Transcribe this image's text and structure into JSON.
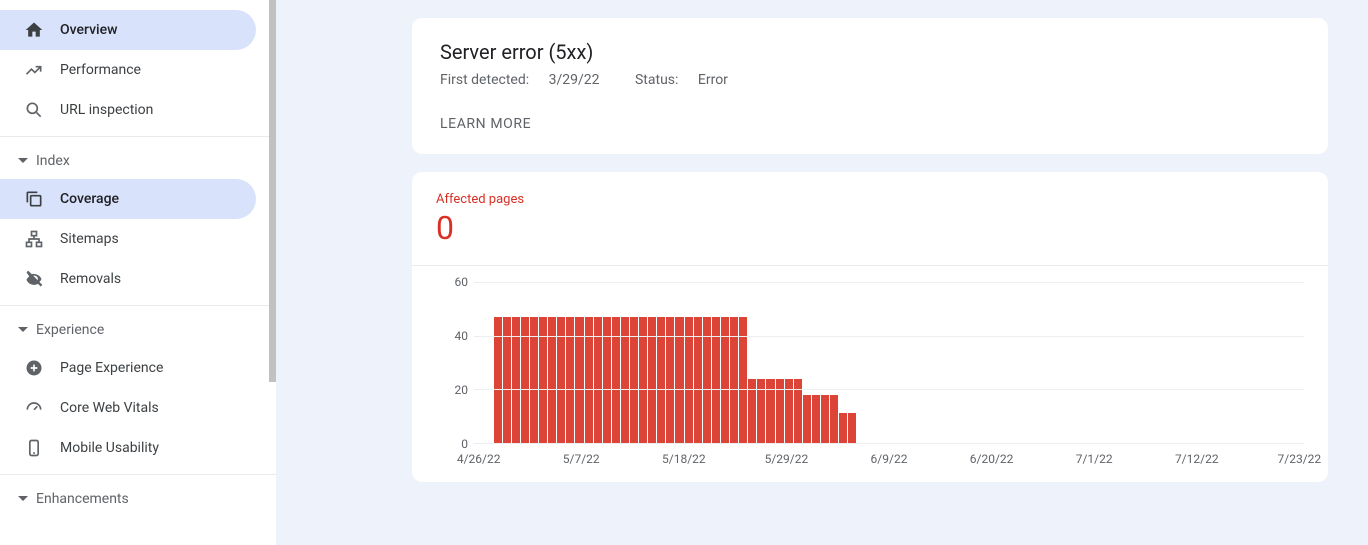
{
  "sidebar": {
    "items": [
      {
        "label": "Overview",
        "icon": "home"
      },
      {
        "label": "Performance",
        "icon": "trending"
      },
      {
        "label": "URL inspection",
        "icon": "search"
      }
    ],
    "sections": [
      {
        "label": "Index",
        "items": [
          {
            "label": "Coverage",
            "icon": "copy",
            "selected": true
          },
          {
            "label": "Sitemaps",
            "icon": "sitemap"
          },
          {
            "label": "Removals",
            "icon": "strike"
          }
        ]
      },
      {
        "label": "Experience",
        "items": [
          {
            "label": "Page Experience",
            "icon": "plus-circle"
          },
          {
            "label": "Core Web Vitals",
            "icon": "speed"
          },
          {
            "label": "Mobile Usability",
            "icon": "mobile"
          }
        ]
      },
      {
        "label": "Enhancements",
        "items": []
      }
    ]
  },
  "header_card": {
    "title": "Server error (5xx)",
    "first_detected_label": "First detected:",
    "first_detected_value": "3/29/22",
    "status_label": "Status:",
    "status_value": "Error",
    "learn_more": "LEARN MORE"
  },
  "chart_card": {
    "label": "Affected pages",
    "value": "0"
  },
  "chart_data": {
    "type": "bar",
    "title": "Affected pages",
    "xlabel": "",
    "ylabel": "",
    "ylim": [
      0,
      60
    ],
    "y_ticks": [
      0,
      20,
      40,
      60
    ],
    "categories": [
      "4/26/22",
      "4/27/22",
      "4/28/22",
      "4/29/22",
      "4/30/22",
      "5/1/22",
      "5/2/22",
      "5/3/22",
      "5/4/22",
      "5/5/22",
      "5/6/22",
      "5/7/22",
      "5/8/22",
      "5/9/22",
      "5/10/22",
      "5/11/22",
      "5/12/22",
      "5/13/22",
      "5/14/22",
      "5/15/22",
      "5/16/22",
      "5/17/22",
      "5/18/22",
      "5/19/22",
      "5/20/22",
      "5/21/22",
      "5/22/22",
      "5/23/22",
      "5/24/22",
      "5/25/22",
      "5/26/22",
      "5/27/22",
      "5/28/22",
      "5/29/22",
      "5/30/22",
      "5/31/22",
      "6/1/22",
      "6/2/22",
      "6/3/22",
      "6/4/22",
      "6/5/22",
      "6/6/22",
      "6/7/22",
      "6/8/22",
      "6/9/22",
      "6/10/22",
      "6/11/22",
      "6/12/22",
      "6/13/22",
      "6/14/22",
      "6/15/22",
      "6/16/22",
      "6/17/22",
      "6/18/22",
      "6/19/22",
      "6/20/22",
      "6/21/22",
      "6/22/22",
      "6/23/22",
      "6/24/22",
      "6/25/22",
      "6/26/22",
      "6/27/22",
      "6/28/22",
      "6/29/22",
      "6/30/22",
      "7/1/22",
      "7/2/22",
      "7/3/22",
      "7/4/22",
      "7/5/22",
      "7/6/22",
      "7/7/22",
      "7/8/22",
      "7/9/22",
      "7/10/22",
      "7/11/22",
      "7/12/22",
      "7/13/22",
      "7/14/22",
      "7/15/22",
      "7/16/22",
      "7/17/22",
      "7/18/22",
      "7/19/22",
      "7/20/22",
      "7/21/22",
      "7/22/22",
      "7/23/22"
    ],
    "values": [
      0,
      47,
      47,
      47,
      47,
      47,
      47,
      47,
      47,
      47,
      47,
      47,
      47,
      47,
      47,
      47,
      47,
      47,
      47,
      47,
      47,
      47,
      47,
      47,
      47,
      47,
      47,
      47,
      47,
      24,
      24,
      24,
      24,
      24,
      24,
      18,
      18,
      18,
      18,
      11,
      11,
      0,
      0,
      0,
      0,
      0,
      0,
      0,
      0,
      0,
      0,
      0,
      0,
      0,
      0,
      0,
      0,
      0,
      0,
      0,
      0,
      0,
      0,
      0,
      0,
      0,
      0,
      0,
      0,
      0,
      0,
      0,
      0,
      0,
      0,
      0,
      0,
      0,
      0,
      0,
      0,
      0,
      0,
      0,
      0,
      0,
      0,
      0,
      0
    ],
    "x_tick_labels": [
      "4/26/22",
      "5/7/22",
      "5/18/22",
      "5/29/22",
      "6/9/22",
      "6/20/22",
      "7/1/22",
      "7/12/22",
      "7/23/22"
    ]
  }
}
